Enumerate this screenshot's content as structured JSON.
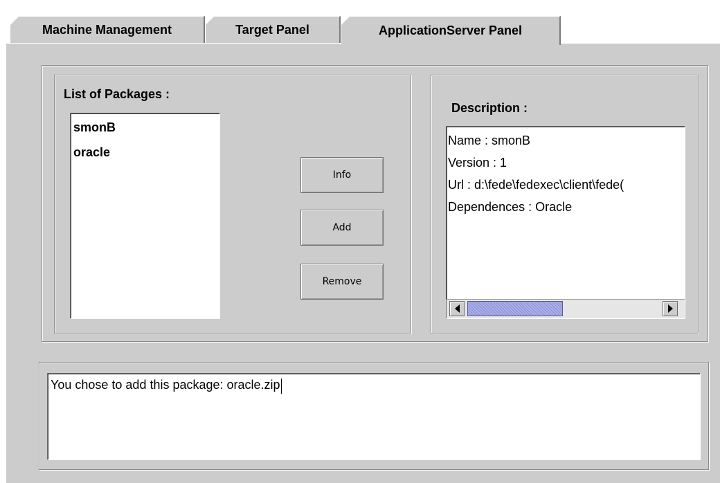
{
  "tabs": [
    {
      "label": "Machine Management",
      "active": false
    },
    {
      "label": "Target Panel",
      "active": false
    },
    {
      "label": "ApplicationServer Panel",
      "active": true
    }
  ],
  "packages": {
    "title": "List of Packages :",
    "items": [
      "smonB",
      "oracle"
    ]
  },
  "buttons": {
    "info": "Info",
    "add": "Add",
    "remove": "Remove"
  },
  "description": {
    "title": "Description :",
    "lines": [
      "Name : smonB",
      "Version : 1",
      "Url : d:\\fede\\fedexec\\client\\fede(",
      "Dependences : Oracle"
    ]
  },
  "output": {
    "text": "You chose to add this package: oracle.zip"
  },
  "colors": {
    "panel_bg": "#cccccc",
    "scroll_thumb": "#aab0e8"
  },
  "icons": {
    "scroll_left": "triangle-left",
    "scroll_right": "triangle-right"
  }
}
